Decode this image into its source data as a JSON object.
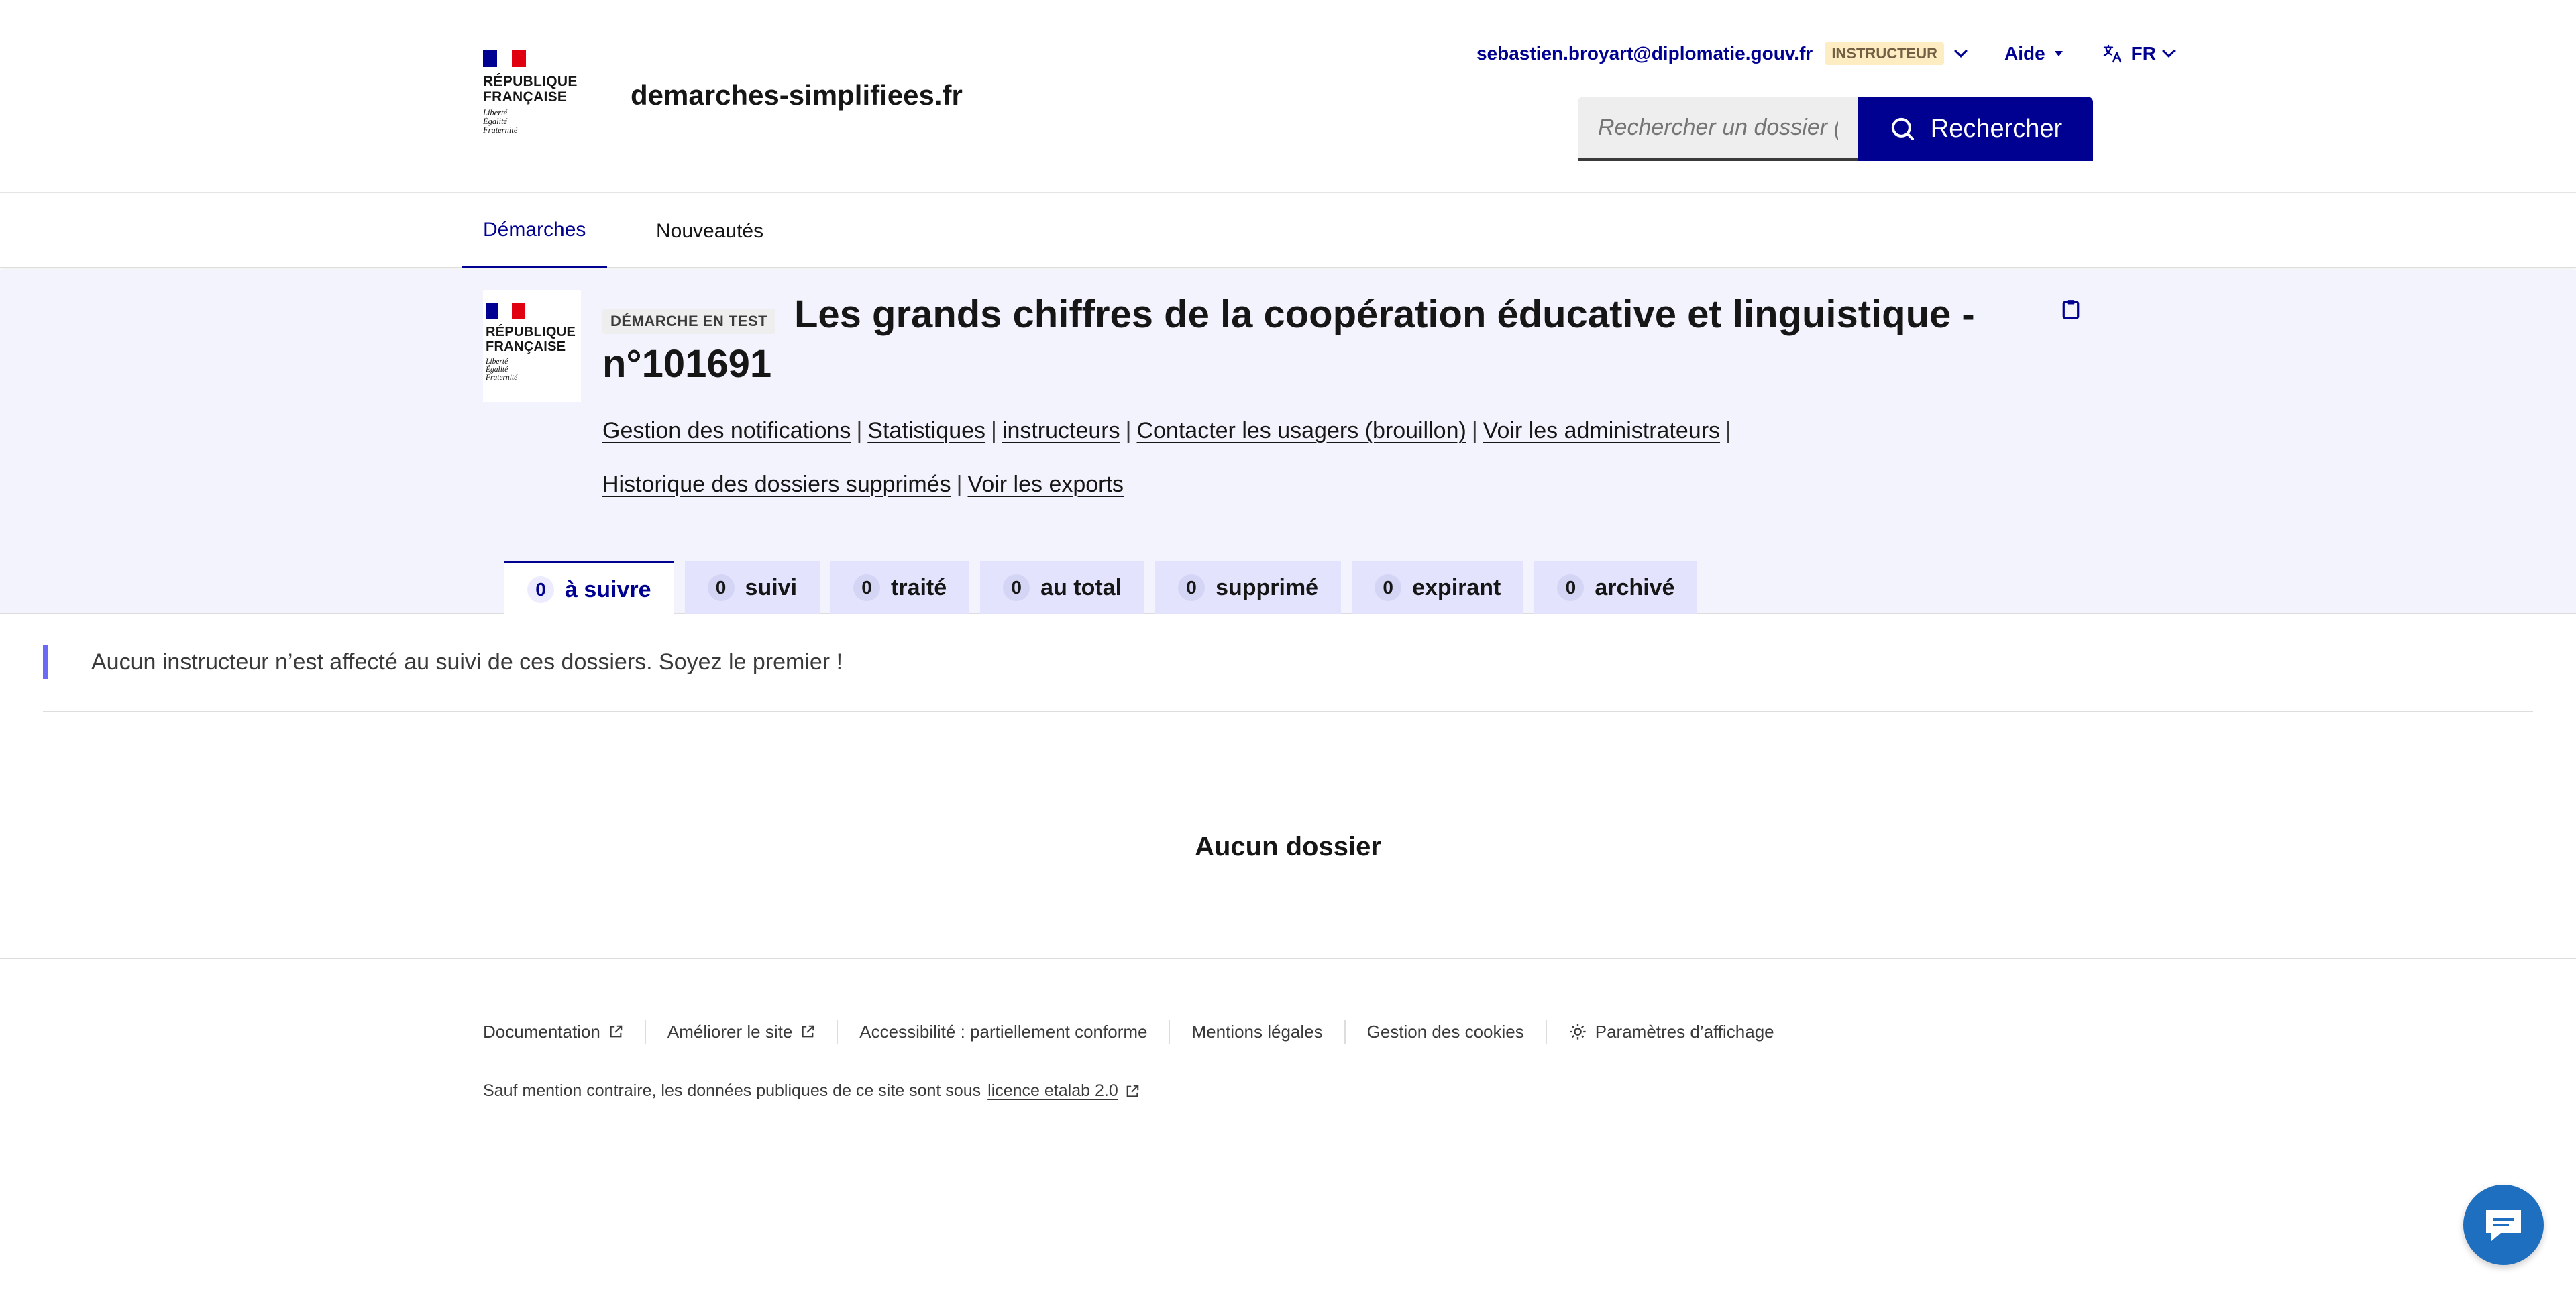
{
  "header": {
    "republique": "RÉPUBLIQUE\nFRANÇAISE",
    "motto": "Liberté\nÉgalité\nFraternité",
    "site_name": "demarches-simplifiees.fr",
    "user_email": "sebastien.broyart@diplomatie.gouv.fr",
    "role_badge": "INSTRUCTEUR",
    "help_label": "Aide",
    "lang_label": "FR",
    "search_placeholder": "Rechercher un dossier (",
    "search_button": "Rechercher"
  },
  "nav": {
    "items": [
      {
        "label": "Démarches",
        "active": true
      },
      {
        "label": "Nouveautés",
        "active": false
      }
    ]
  },
  "procedure": {
    "test_badge": "DÉMARCHE EN TEST",
    "title": "Les grands chiffres de la coopération éducative et linguistique - n°101691",
    "links": [
      "Gestion des notifications",
      "Statistiques",
      "instructeurs",
      "Contacter les usagers (brouillon)",
      "Voir les administrateurs",
      "Historique des dossiers supprimés",
      "Voir les exports"
    ],
    "tabs": [
      {
        "count": "0",
        "label": "à suivre",
        "active": true
      },
      {
        "count": "0",
        "label": "suivi",
        "active": false
      },
      {
        "count": "0",
        "label": "traité",
        "active": false
      },
      {
        "count": "0",
        "label": "au total",
        "active": false
      },
      {
        "count": "0",
        "label": "supprimé",
        "active": false
      },
      {
        "count": "0",
        "label": "expirant",
        "active": false
      },
      {
        "count": "0",
        "label": "archivé",
        "active": false
      }
    ]
  },
  "main": {
    "notice": "Aucun instructeur n’est affecté au suivi de ces dossiers. Soyez le premier !",
    "empty_state": "Aucun dossier"
  },
  "footer": {
    "links": [
      "Documentation",
      "Améliorer le site",
      "Accessibilité : partiellement conforme",
      "Mentions légales",
      "Gestion des cookies",
      "Paramètres d’affichage"
    ],
    "licence_prefix": "Sauf mention contraire, les données publiques de ce site sont sous",
    "licence_link": "licence etalab 2.0"
  },
  "colors": {
    "primary": "#000091",
    "banner_bg": "#f3f3fd",
    "tab_bg": "#e3e3fd",
    "badge_instructeur_bg": "#feecc2",
    "notice_border": "#6a6af4",
    "chat_button": "#1e6fbf"
  },
  "icons": {
    "search": "search-icon",
    "lang": "translate-icon",
    "copy": "clipboard-icon",
    "external": "external-link-icon",
    "display_settings": "sun-icon",
    "chat": "chat-bubble-icon"
  }
}
